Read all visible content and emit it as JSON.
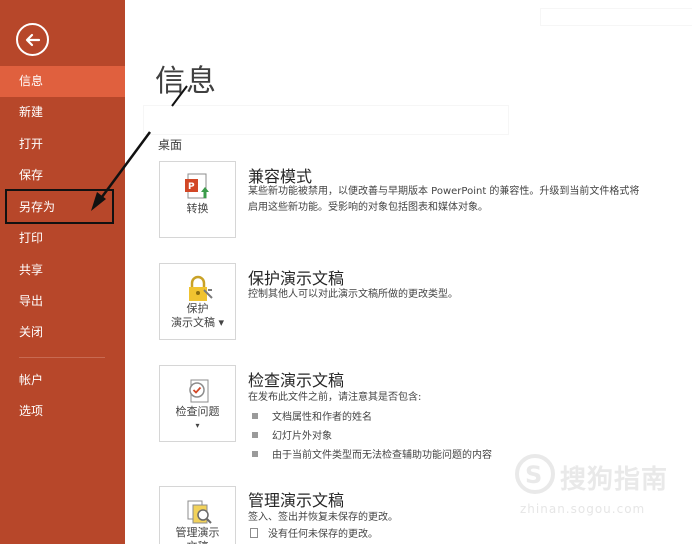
{
  "sidebar": {
    "items": [
      {
        "label": "信息",
        "active": true
      },
      {
        "label": "新建"
      },
      {
        "label": "打开"
      },
      {
        "label": "保存"
      },
      {
        "label": "另存为"
      },
      {
        "label": "打印"
      },
      {
        "label": "共享"
      },
      {
        "label": "导出"
      },
      {
        "label": "关闭"
      },
      {
        "label": "帐户"
      },
      {
        "label": "选项"
      }
    ],
    "icons": {
      "back": "back-arrow-icon"
    },
    "colors": {
      "background": "#b7472a",
      "active": "#e0603e"
    }
  },
  "main": {
    "title": "信息",
    "location": "桌面",
    "sections": [
      {
        "card_label": "转换",
        "icon": "convert-icon",
        "title": "兼容模式",
        "desc_line1": "某些新功能被禁用，以便改善与早期版本 PowerPoint 的兼容性。升级到当前文件格式将",
        "desc_line2": "启用这些新功能。受影响的对象包括图表和媒体对象。"
      },
      {
        "card_label_line1": "保护",
        "card_label_line2": "演示文稿 ▾",
        "icon": "lock-icon",
        "title": "保护演示文稿",
        "desc": "控制其他人可以对此演示文稿所做的更改类型。"
      },
      {
        "card_label_line1": "检查问题",
        "card_label_line2": "▾",
        "icon": "inspect-icon",
        "title": "检查演示文稿",
        "desc": "在发布此文件之前，请注意其是否包含:",
        "bullets": [
          "文档属性和作者的姓名",
          "幻灯片外对象",
          "由于当前文件类型而无法检查辅助功能问题的内容"
        ]
      },
      {
        "card_label_line1": "管理演示",
        "card_label_line2": "文稿",
        "icon": "manage-icon",
        "title": "管理演示文稿",
        "desc": "签入、签出并恢复未保存的更改。",
        "note": "没有任何未保存的更改。"
      }
    ]
  },
  "watermark": {
    "brand": "搜狗指南",
    "url": "zhinan.sogou.com",
    "icon": "sogou-logo-icon"
  }
}
